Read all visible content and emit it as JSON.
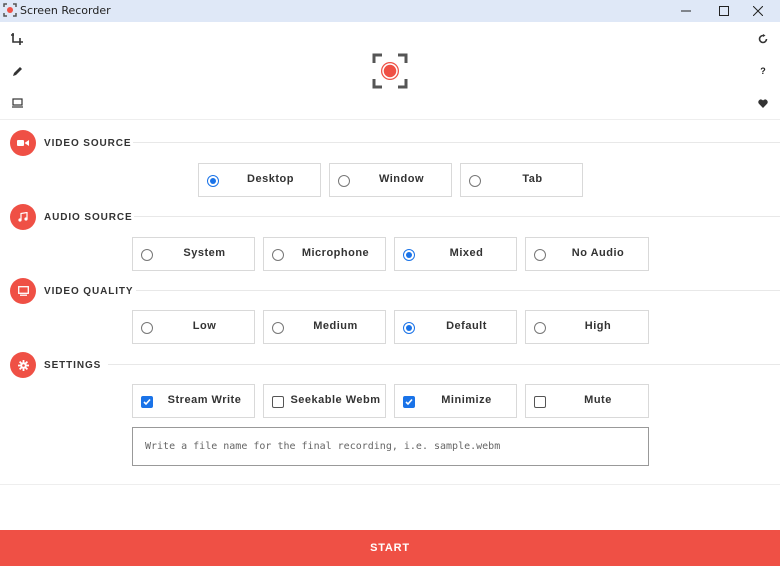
{
  "window": {
    "title": "Screen Recorder",
    "controls": [
      "minimize",
      "maximize",
      "close"
    ]
  },
  "colors": {
    "accent": "#ef5045",
    "titlebar": "#dfe8f7",
    "selected": "#1a73e8"
  },
  "toolbar_left": [
    "crop-icon",
    "pencil-icon",
    "monitor-icon"
  ],
  "toolbar_right": [
    "refresh-icon",
    "help-icon",
    "heart-icon"
  ],
  "toolbar_right_labels": {
    "help": "?"
  },
  "logo": "record-focus-icon",
  "sections": {
    "video_source": {
      "title": "VIDEO SOURCE",
      "icon": "video-camera-icon",
      "options": [
        {
          "label": "Desktop",
          "selected": true
        },
        {
          "label": "Window",
          "selected": false
        },
        {
          "label": "Tab",
          "selected": false
        }
      ]
    },
    "audio_source": {
      "title": "AUDIO SOURCE",
      "icon": "music-note-icon",
      "options": [
        {
          "label": "System",
          "selected": false
        },
        {
          "label": "Microphone",
          "selected": false
        },
        {
          "label": "Mixed",
          "selected": true
        },
        {
          "label": "No Audio",
          "selected": false
        }
      ]
    },
    "video_quality": {
      "title": "VIDEO QUALITY",
      "icon": "display-icon",
      "options": [
        {
          "label": "Low",
          "selected": false
        },
        {
          "label": "Medium",
          "selected": false
        },
        {
          "label": "Default",
          "selected": true
        },
        {
          "label": "High",
          "selected": false
        }
      ]
    },
    "settings": {
      "title": "SETTINGS",
      "icon": "gear-icon",
      "options": [
        {
          "label": "Stream Write",
          "checked": true
        },
        {
          "label": "Seekable Webm",
          "checked": false
        },
        {
          "label": "Minimize",
          "checked": true
        },
        {
          "label": "Mute",
          "checked": false
        }
      ],
      "filename": {
        "value": "",
        "placeholder": "Write a file name for the final recording, i.e. sample.webm"
      }
    }
  },
  "start_button": {
    "label": "START"
  }
}
